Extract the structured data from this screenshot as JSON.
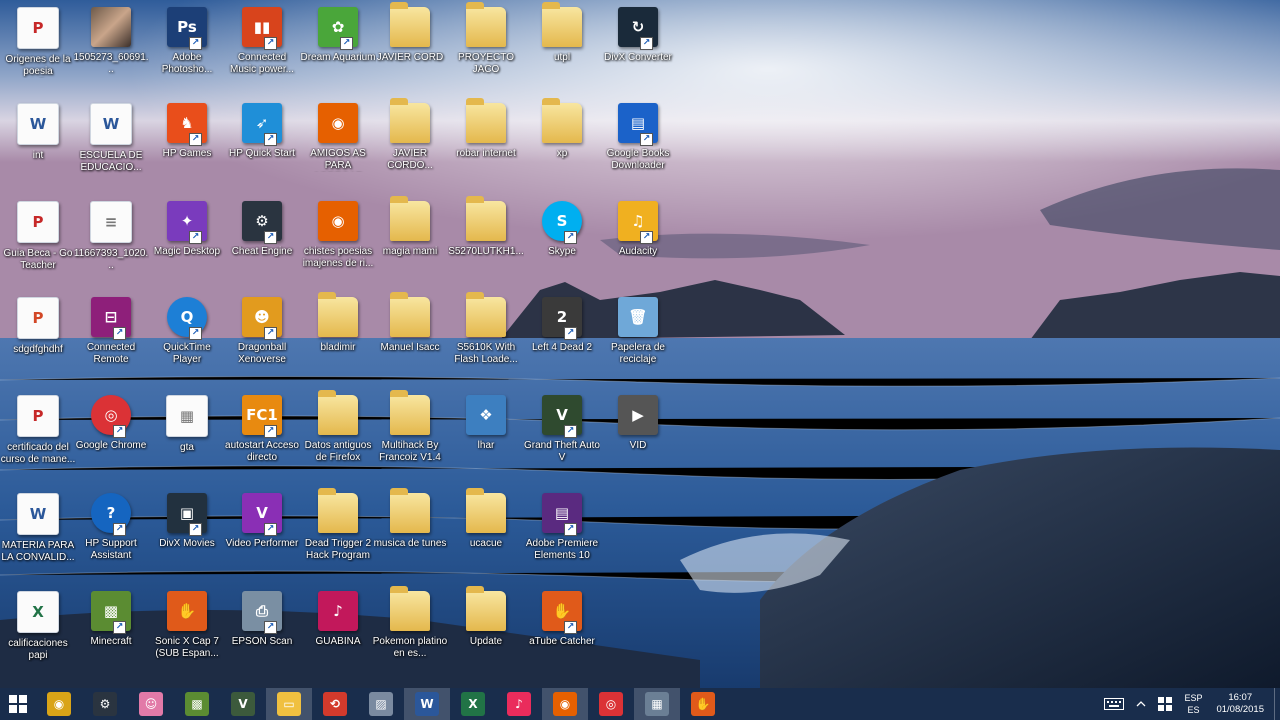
{
  "desktop": {
    "icons": [
      {
        "label": "Origenes de la poesia castellana",
        "kind": "doc pdf",
        "glyph": "P"
      },
      {
        "label": "1505273_60691...",
        "kind": "photo",
        "glyph": ""
      },
      {
        "label": "Adobe Photosho...",
        "kind": "app",
        "glyph": "Ps",
        "color": "#1c3f77",
        "shortcut": true
      },
      {
        "label": "Connected Music power...",
        "kind": "app",
        "glyph": "▮▮",
        "color": "#d8441c",
        "shortcut": true
      },
      {
        "label": "Dream Aquarium",
        "kind": "app",
        "glyph": "✿",
        "color": "#4aa63a",
        "shortcut": true
      },
      {
        "label": "JAVIER CORD",
        "kind": "folder",
        "glyph": ""
      },
      {
        "label": "PROYECTO JACO",
        "kind": "folder",
        "glyph": ""
      },
      {
        "label": "utpl",
        "kind": "folder",
        "glyph": ""
      },
      {
        "label": "DivX Converter",
        "kind": "app",
        "glyph": "↻",
        "color": "#1a2a3a",
        "shortcut": true
      },
      {
        "label": "int",
        "kind": "doc",
        "glyph": "W"
      },
      {
        "label": "ESCUELA DE EDUCACIO...",
        "kind": "doc",
        "glyph": "W"
      },
      {
        "label": "HP Games",
        "kind": "app",
        "glyph": "♞",
        "color": "#e94e1b",
        "shortcut": true
      },
      {
        "label": "HP Quick Start",
        "kind": "app",
        "glyph": "➶",
        "color": "#1f8fd8",
        "shortcut": true
      },
      {
        "label": "AMIGOS AS PARA AGREGAR",
        "kind": "app",
        "glyph": "◉",
        "color": "#e66000",
        "shortcut": false
      },
      {
        "label": "JAVIER CORDO...",
        "kind": "folder",
        "glyph": ""
      },
      {
        "label": "robar internet",
        "kind": "folder",
        "glyph": ""
      },
      {
        "label": "xp",
        "kind": "folder",
        "glyph": ""
      },
      {
        "label": "Google Books Downloader",
        "kind": "app",
        "glyph": "▤",
        "color": "#1b62c9",
        "shortcut": true
      },
      {
        "label": "Guia Beca - Go Teacher",
        "kind": "doc pdf",
        "glyph": "P"
      },
      {
        "label": "11667393_1020...",
        "kind": "doc img",
        "glyph": "≡"
      },
      {
        "label": "Magic Desktop",
        "kind": "app",
        "glyph": "✦",
        "color": "#7a3bbd",
        "shortcut": true
      },
      {
        "label": "Cheat Engine",
        "kind": "app",
        "glyph": "⚙",
        "color": "#2a3440",
        "shortcut": true
      },
      {
        "label": "chistes poesias imajenes de ri...",
        "kind": "app",
        "glyph": "◉",
        "color": "#e66000",
        "shortcut": false
      },
      {
        "label": "magia mami",
        "kind": "folder",
        "glyph": ""
      },
      {
        "label": "S5270LUTKH1...",
        "kind": "folder",
        "glyph": ""
      },
      {
        "label": "Skype",
        "kind": "app",
        "glyph": "S",
        "color": "#00aff0",
        "shortcut": true,
        "round": true
      },
      {
        "label": "Audacity",
        "kind": "app",
        "glyph": "♫",
        "color": "#f0b020",
        "shortcut": true
      },
      {
        "label": "sdgdfghdhf",
        "kind": "doc ppt",
        "glyph": "P"
      },
      {
        "label": "Connected Remote",
        "kind": "app",
        "glyph": "⊟",
        "color": "#8e1f7a",
        "shortcut": true
      },
      {
        "label": "QuickTime Player",
        "kind": "app",
        "glyph": "Q",
        "color": "#1d7fd6",
        "shortcut": true,
        "round": true
      },
      {
        "label": "Dragonball Xenoverse",
        "kind": "app",
        "glyph": "☻",
        "color": "#e29b1e",
        "shortcut": true
      },
      {
        "label": "bladimir",
        "kind": "folder",
        "glyph": ""
      },
      {
        "label": "Manuel Isacc",
        "kind": "folder",
        "glyph": ""
      },
      {
        "label": "S5610K With Flash Loade...",
        "kind": "folder",
        "glyph": ""
      },
      {
        "label": "Left 4 Dead 2",
        "kind": "app",
        "glyph": "2",
        "color": "#3a3a3a",
        "shortcut": true
      },
      {
        "label": "Papelera de reciclaje",
        "kind": "app",
        "glyph": "🗑",
        "color": "#6fa8d8",
        "shortcut": false
      },
      {
        "label": "certificado del curso de mane...",
        "kind": "doc pdf",
        "glyph": "P"
      },
      {
        "label": "Google Chrome",
        "kind": "app",
        "glyph": "◎",
        "color": "#db3236",
        "shortcut": true,
        "round": true
      },
      {
        "label": "gta",
        "kind": "doc img",
        "glyph": "▦"
      },
      {
        "label": "autostart Acceso directo",
        "kind": "app",
        "glyph": "FC1",
        "color": "#e88a10",
        "shortcut": true
      },
      {
        "label": "Datos antiguos de Firefox",
        "kind": "folder",
        "glyph": ""
      },
      {
        "label": "Multihack By Francoiz V1.4",
        "kind": "folder",
        "glyph": ""
      },
      {
        "label": "lhar",
        "kind": "app",
        "glyph": "❖",
        "color": "#3d7fc0",
        "shortcut": false
      },
      {
        "label": "Grand Theft Auto V",
        "kind": "app",
        "glyph": "V",
        "color": "#2f4a2f",
        "shortcut": true
      },
      {
        "label": "VID",
        "kind": "app",
        "glyph": "▶",
        "color": "#555",
        "shortcut": false
      },
      {
        "label": "MATERIA PARA LA CONVALID...",
        "kind": "doc",
        "glyph": "W"
      },
      {
        "label": "HP Support Assistant",
        "kind": "app",
        "glyph": "?",
        "color": "#1565c0",
        "shortcut": true,
        "round": true
      },
      {
        "label": "DivX Movies",
        "kind": "app",
        "glyph": "▣",
        "color": "#22313f",
        "shortcut": true
      },
      {
        "label": "Video Performer",
        "kind": "app",
        "glyph": "V",
        "color": "#8a2fb5",
        "shortcut": true
      },
      {
        "label": "Dead Trigger 2 Hack Program",
        "kind": "folder",
        "glyph": ""
      },
      {
        "label": "musica de tunes",
        "kind": "folder",
        "glyph": ""
      },
      {
        "label": "ucacue",
        "kind": "folder",
        "glyph": ""
      },
      {
        "label": "Adobe Premiere Elements 10",
        "kind": "app",
        "glyph": "▤",
        "color": "#5a2a80",
        "shortcut": true
      },
      {
        "label": "calificaciones papi",
        "kind": "doc xls",
        "glyph": "X"
      },
      {
        "label": "Minecraft",
        "kind": "app",
        "glyph": "▩",
        "color": "#5b8c32",
        "shortcut": true
      },
      {
        "label": "Sonic X Cap 7 (SUB Espan...",
        "kind": "app",
        "glyph": "✋",
        "color": "#e05a1a",
        "shortcut": false
      },
      {
        "label": "EPSON Scan",
        "kind": "app",
        "glyph": "⎙",
        "color": "#7a8fa3",
        "shortcut": true
      },
      {
        "label": "GUABINA",
        "kind": "app",
        "glyph": "♪",
        "color": "#c2185b",
        "shortcut": false
      },
      {
        "label": "Pokemon platino en es...",
        "kind": "folder",
        "glyph": ""
      },
      {
        "label": "Update",
        "kind": "folder",
        "glyph": ""
      },
      {
        "label": "aTube Catcher",
        "kind": "app",
        "glyph": "✋",
        "color": "#e05a1a",
        "shortcut": true
      }
    ]
  },
  "taskbar": {
    "items": [
      {
        "name": "start",
        "glyph": "⊞",
        "color": "#ffffff"
      },
      {
        "name": "disc-burner",
        "glyph": "◉",
        "color": "#d9a417"
      },
      {
        "name": "cheat-engine",
        "glyph": "⚙",
        "color": "#2a3440"
      },
      {
        "name": "character",
        "glyph": "☺",
        "color": "#e27aa8"
      },
      {
        "name": "minecraft",
        "glyph": "▩",
        "color": "#5b8c32"
      },
      {
        "name": "gta",
        "glyph": "V",
        "color": "#3c5a3c"
      },
      {
        "name": "file-explorer",
        "glyph": "▭",
        "color": "#f0c040",
        "active": true
      },
      {
        "name": "ccleaner",
        "glyph": "⟲",
        "color": "#d33a2c"
      },
      {
        "name": "photos",
        "glyph": "▨",
        "color": "#7a8aa0"
      },
      {
        "name": "word",
        "glyph": "W",
        "color": "#2b579a",
        "active": true
      },
      {
        "name": "excel",
        "glyph": "X",
        "color": "#217346"
      },
      {
        "name": "itunes",
        "glyph": "♪",
        "color": "#ea2c5c"
      },
      {
        "name": "firefox",
        "glyph": "◉",
        "color": "#e66000",
        "active": true
      },
      {
        "name": "chrome",
        "glyph": "◎",
        "color": "#db3236"
      },
      {
        "name": "calculator",
        "glyph": "▦",
        "color": "#6b7f95",
        "active": true
      },
      {
        "name": "atube",
        "glyph": "✋",
        "color": "#e05a1a"
      }
    ],
    "tray": {
      "keyboard_icon": "keyboard-icon",
      "lang_top": "ESP",
      "lang_bottom": "ES",
      "time": "16:07",
      "date": "01/08/2015"
    }
  }
}
